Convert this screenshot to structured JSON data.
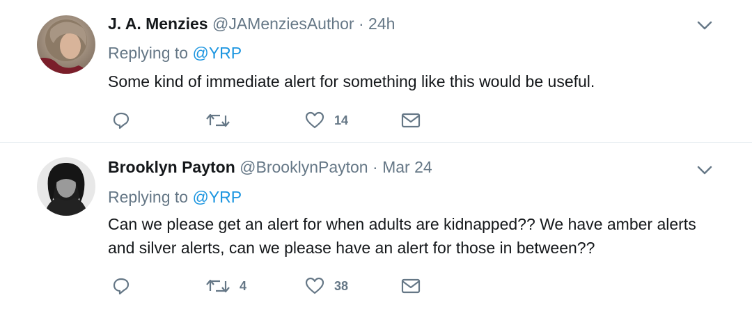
{
  "tweets": [
    {
      "name": "J. A. Menzies",
      "handle": "@JAMenziesAuthor",
      "separator": "·",
      "time": "24h",
      "replying_prefix": "Replying to ",
      "replying_to": "@YRP",
      "text": "Some kind of immediate alert for something like this would be useful.",
      "reply_count": "",
      "retweet_count": "",
      "like_count": "14",
      "avatar_icon": "avatar-photo-icon"
    },
    {
      "name": "Brooklyn Payton",
      "handle": "@BrooklynPayton",
      "separator": "·",
      "time": "Mar 24",
      "replying_prefix": "Replying to ",
      "replying_to": "@YRP",
      "text": "Can we please get an alert for when adults are kidnapped?? We have amber alerts and silver alerts, can we please have an alert for those in between??",
      "reply_count": "",
      "retweet_count": "4",
      "like_count": "38",
      "avatar_icon": "avatar-photo-icon"
    }
  ],
  "colors": {
    "text_primary": "#14171a",
    "text_secondary": "#657786",
    "link": "#1b95e0",
    "divider": "#e6ecf0"
  }
}
